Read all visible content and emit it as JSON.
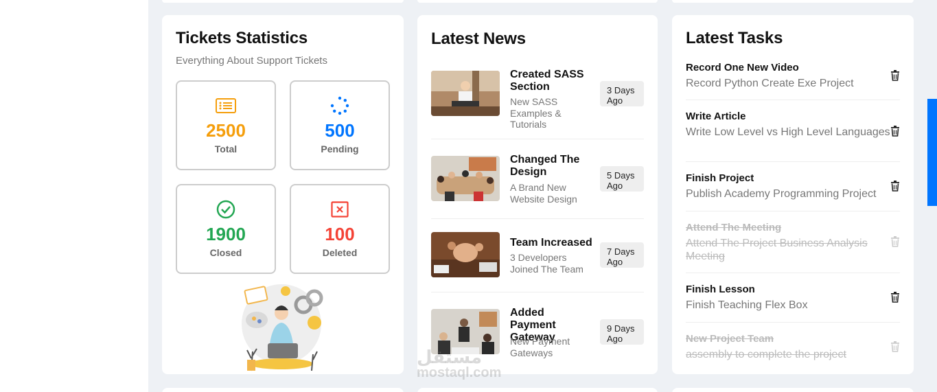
{
  "tickets": {
    "title": "Tickets Statistics",
    "subtitle": "Everything About Support Tickets",
    "stats": [
      {
        "value": "2500",
        "label": "Total",
        "color": "#f59e0b",
        "icon": "list-icon"
      },
      {
        "value": "500",
        "label": "Pending",
        "color": "#0075ff",
        "icon": "spinner-icon"
      },
      {
        "value": "1900",
        "label": "Closed",
        "color": "#22a652",
        "icon": "check-circle-icon"
      },
      {
        "value": "100",
        "label": "Deleted",
        "color": "#f44336",
        "icon": "x-square-icon"
      }
    ]
  },
  "news": {
    "title": "Latest News",
    "items": [
      {
        "title": "Created SASS Section",
        "desc": "New SASS Examples & Tutorials",
        "date": "3 Days Ago"
      },
      {
        "title": "Changed The Design",
        "desc": "A Brand New Website Design",
        "date": "5 Days Ago"
      },
      {
        "title": "Team Increased",
        "desc": "3 Developers Joined The Team",
        "date": "7 Days Ago"
      },
      {
        "title": "Added Payment Gateway",
        "desc": "New Payment Gateways",
        "date": "9 Days Ago"
      }
    ]
  },
  "tasks": {
    "title": "Latest Tasks",
    "items": [
      {
        "title": "Record One New Video",
        "desc": "Record Python Create Exe Project",
        "done": false
      },
      {
        "title": "Write Article",
        "desc": "Write Low Level vs High Level Languages",
        "done": false
      },
      {
        "title": "Finish Project",
        "desc": "Publish Academy Programming Project",
        "done": false
      },
      {
        "title": "Attend The Meeting",
        "desc": "Attend The Project Business Analysis Meeting",
        "done": true
      },
      {
        "title": "Finish Lesson",
        "desc": "Finish Teaching Flex Box",
        "done": false
      },
      {
        "title": "New Project Team",
        "desc": "assembly to complete the project",
        "done": true
      }
    ]
  },
  "watermark": {
    "arabic": "مستقل",
    "latin": "mostaql.com"
  },
  "colors": {
    "accent": "#0075ff",
    "background": "#eef1f5"
  }
}
